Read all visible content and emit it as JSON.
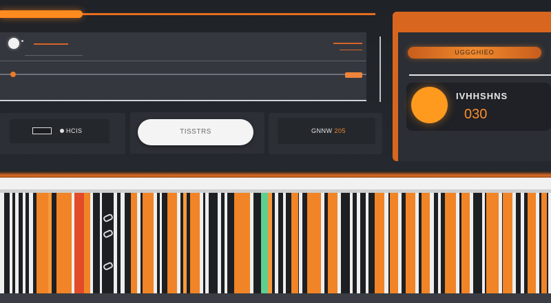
{
  "header": {
    "progress": 0.22
  },
  "controls": {
    "left_label": "HCIS",
    "center_button": "TISSTRS",
    "right_label_prefix": "GNNW",
    "right_label_accent": "205"
  },
  "side_panel": {
    "banner": "UGGGHIEO",
    "title": "IVHHSHNS",
    "value": "030"
  },
  "colors": {
    "accent": "#ff8a1e",
    "panel": "#34373d",
    "background": "#22252b",
    "highlight": "#5fcf8f"
  },
  "icons": {
    "knob": "toggle-knob-icon",
    "tag": "tag-icon",
    "dot": "status-dot-icon",
    "big_dot": "record-icon"
  }
}
